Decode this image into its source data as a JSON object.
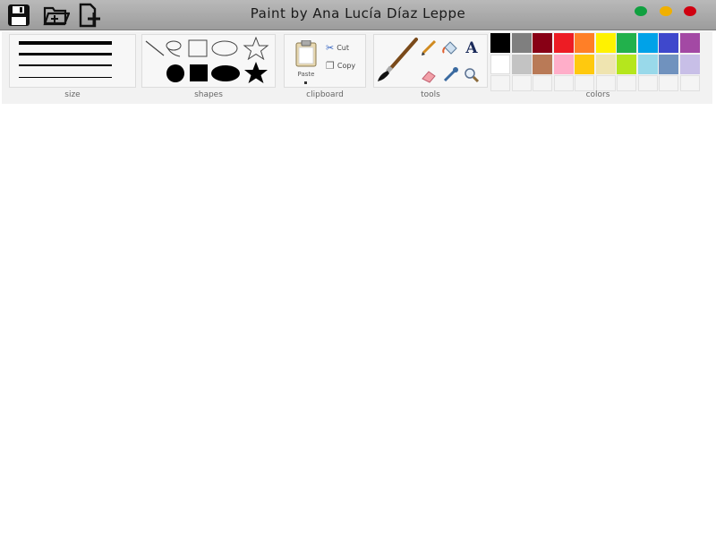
{
  "window": {
    "title": "Paint by Ana Lucía Díaz Leppe",
    "controls": {
      "minimize_color": "#10a040",
      "maximize_color": "#f0b000",
      "close_color": "#d00010"
    }
  },
  "quick_access": [
    {
      "name": "save",
      "icon": "floppy-disk-icon"
    },
    {
      "name": "open",
      "icon": "folder-open-icon"
    },
    {
      "name": "new",
      "icon": "new-file-icon"
    }
  ],
  "ribbon": {
    "size": {
      "label": "size",
      "line_weights": [
        "4px",
        "3px",
        "2px",
        "1px"
      ]
    },
    "shapes": {
      "label": "shapes",
      "items": [
        "line",
        "curve",
        "rectangle",
        "ellipse",
        "star",
        "filled-circle",
        "filled-rectangle",
        "filled-ellipse",
        "filled-star"
      ]
    },
    "clipboard": {
      "label": "clipboard",
      "paste_label": "Paste",
      "cut_label": "Cut",
      "copy_label": "Copy"
    },
    "tools": {
      "label": "tools",
      "items": [
        "brush-icon",
        "pencil-icon",
        "fill-bucket-icon",
        "text-icon",
        "eraser-icon",
        "color-picker-icon",
        "magnifier-icon"
      ],
      "text_glyph": "A"
    },
    "colors": {
      "label": "colors",
      "row1": [
        "#000000",
        "#7f7f7f",
        "#880015",
        "#ed1c24",
        "#ff7f27",
        "#fff200",
        "#22b14c",
        "#00a2e8",
        "#3f48cc",
        "#a349a4"
      ],
      "row2": [
        "#ffffff",
        "#c3c3c3",
        "#b97a57",
        "#ffaec9",
        "#ffc90e",
        "#efe4b0",
        "#b5e61d",
        "#99d9ea",
        "#7092be",
        "#c8bfe7"
      ],
      "row3_count": 10
    }
  }
}
